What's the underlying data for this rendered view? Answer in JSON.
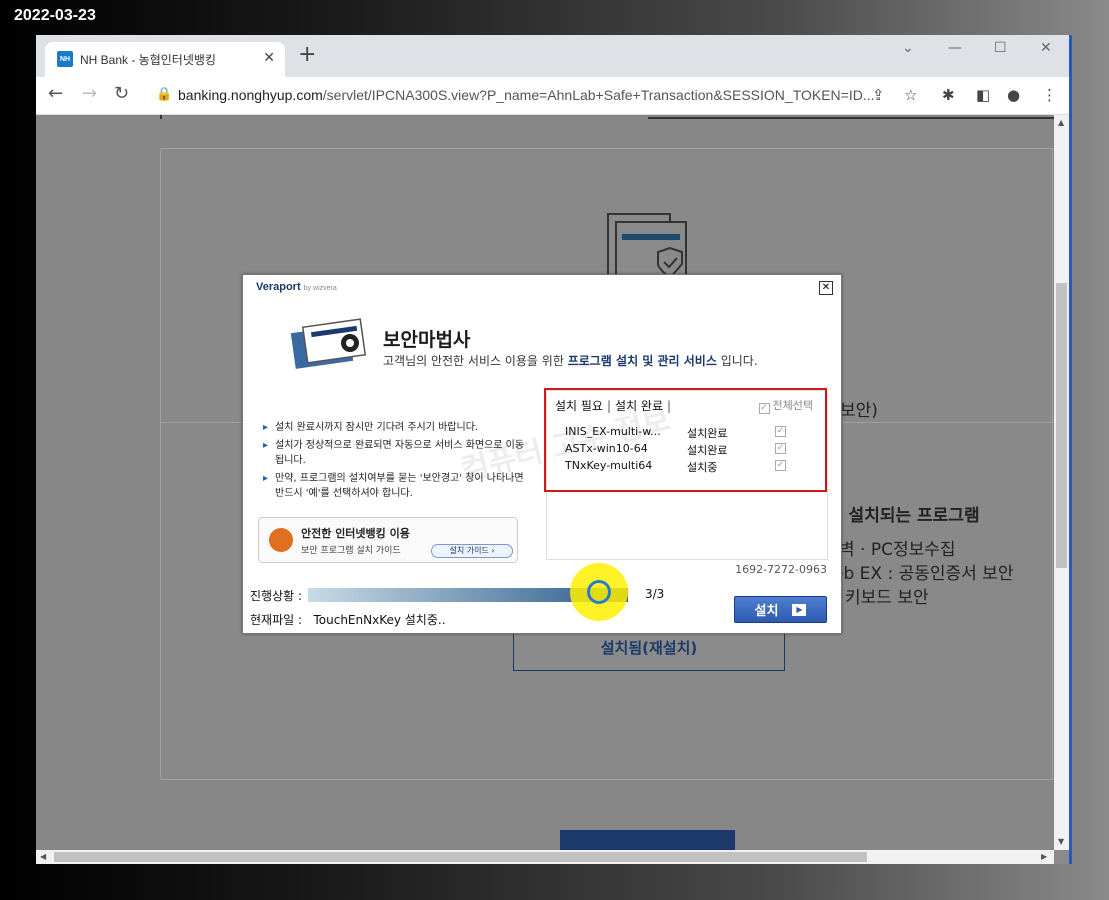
{
  "date_stamp": "2022-03-23",
  "browser": {
    "tab_title": "NH Bank - 농협인터넷뱅킹",
    "favicon_text": "NH",
    "url_host": "banking.nonghyup.com",
    "url_path": "/servlet/IPCNA300S.view?P_name=AhnLab+Safe+Transaction&SESSION_TOKEN=ID..."
  },
  "background_page": {
    "paren_text": "보안)",
    "heading": "동 설치되는 프로그램",
    "items": [
      "벽 · PC정보수집",
      "eb EX : 공동인증서 보안",
      "키보드 보안"
    ],
    "reinstall_button": "설치됨(재설치)"
  },
  "dialog": {
    "brand": "Veraport",
    "brand_sub": "by wizvera",
    "title": "보안마법사",
    "subtitle_pre": "고객님의 안전한 서비스 이용을 위한 ",
    "subtitle_bold": "프로그램 설치 및 관리 서비스",
    "subtitle_post": " 입니다.",
    "notes": [
      "설치 완료시까지 잠시만 기다려 주시기 바랍니다.",
      "설치가 정상적으로 완료되면 자동으로 서비스 화면으로 이동됩니다.",
      "만약, 프로그램의 설치여부를 묻는 '보안경고' 창이 나타나면 반드시 '예'를 선택하셔야 합니다."
    ],
    "guide": {
      "title": "안전한 인터넷뱅킹 이용",
      "sub": "보안 프로그램 설치 가이드",
      "button": "설치 가이드"
    },
    "tabs": {
      "needed": "설치 필요",
      "done": "설치 완료"
    },
    "select_all": "전체선택",
    "programs": [
      {
        "name": "INIS_EX-multi-w...",
        "status": "설치완료"
      },
      {
        "name": "ASTx-win10-64",
        "status": "설치완료"
      },
      {
        "name": "TNxKey-multi64",
        "status": "설치중"
      }
    ],
    "serial": "1692-7272-0963",
    "progress_label": "진행상황 :",
    "progress_fraction": 1.0,
    "progress_count": "3/3",
    "file_label": "현재파일 :",
    "current_file": "TouchEnNxKey 설치중..",
    "install_button": "설치",
    "watermark": "컴퓨터 고수 정보"
  }
}
